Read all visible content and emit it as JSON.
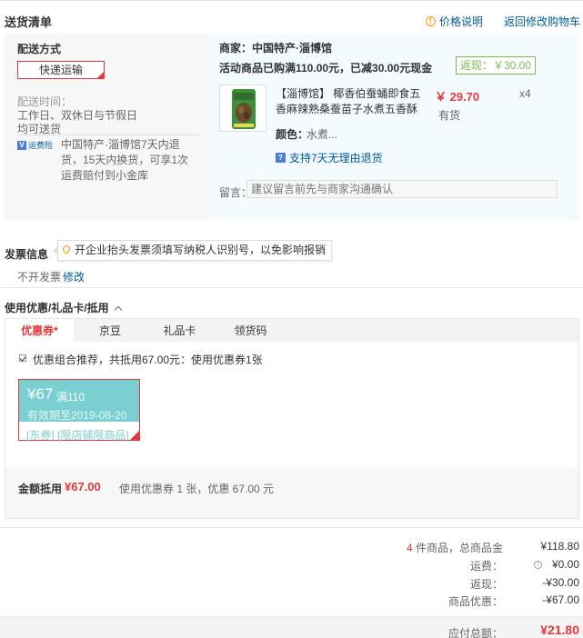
{
  "section_title": "送货清单",
  "price_note": "价格说明",
  "back_to_cart": "返回修改购物车",
  "shipping": {
    "method_label": "配送方式",
    "method_value": "快递运输",
    "time_label": "配送时间：",
    "time_line1": "工作日、双休日与节假日",
    "time_line2": "均可送货",
    "insurance_icon": "运费险",
    "insurance_desc": "中国特产·淄博馆7天内退货，15天内换货，可享1次运费赔付到小金库"
  },
  "merchant": {
    "name": "商家：中国特产·淄博馆",
    "promo": "活动商品已购满110.00元，已减30.00元现金",
    "rebate": "返现：￥30.00"
  },
  "product": {
    "name": "【淄博馆】 椰香伯蚕蛹即食五香麻辣熟桑蚕苗子水煮五香酥",
    "price": "￥ 29.70",
    "qty": "x4",
    "stock": "有货",
    "color_label": "颜色：",
    "color_value": "水煮...",
    "return_note": "支持7天无理由退货"
  },
  "memo": {
    "label": "留言：",
    "placeholder": "建议留言前先与商家沟通确认"
  },
  "invoice": {
    "title": "发票信息",
    "tip": "开企业抬头发票须填写纳税人识别号，以免影响报销",
    "value": "不开发票",
    "edit": "修改"
  },
  "coupon": {
    "title": "使用优惠/礼品卡/抵用",
    "tabs": [
      "优惠券*",
      "京豆",
      "礼品卡",
      "领货码"
    ],
    "combo_text": "优惠组合推荐，共抵用67.00元：使用优惠券1张",
    "card": {
      "amount": "¥67",
      "condition": "满110",
      "valid": "有效期至2019-08-20",
      "scope": "[东券] [限店铺限商品]"
    },
    "sum_label": "金额抵用",
    "sum_value": "¥67.00",
    "sum_desc": "使用优惠券 1 张，优惠 67.00 元"
  },
  "totals": {
    "count_num": "4",
    "count_label": " 件商品，总商品金",
    "goods_total": "¥118.80",
    "shipping_label": "运费：",
    "shipping_value": "¥0.00",
    "rebate_label": "返现：",
    "rebate_value": "-¥30.00",
    "discount_label": "商品优惠：",
    "discount_value": "-¥67.00",
    "pay_label": "应付总额：",
    "pay_value": "¥21.80"
  },
  "colors": {
    "accent_red": "#e4393c",
    "link_blue": "#005aa0",
    "coupon_teal": "#7ad0d1",
    "rebate_green": "#7abd54"
  }
}
